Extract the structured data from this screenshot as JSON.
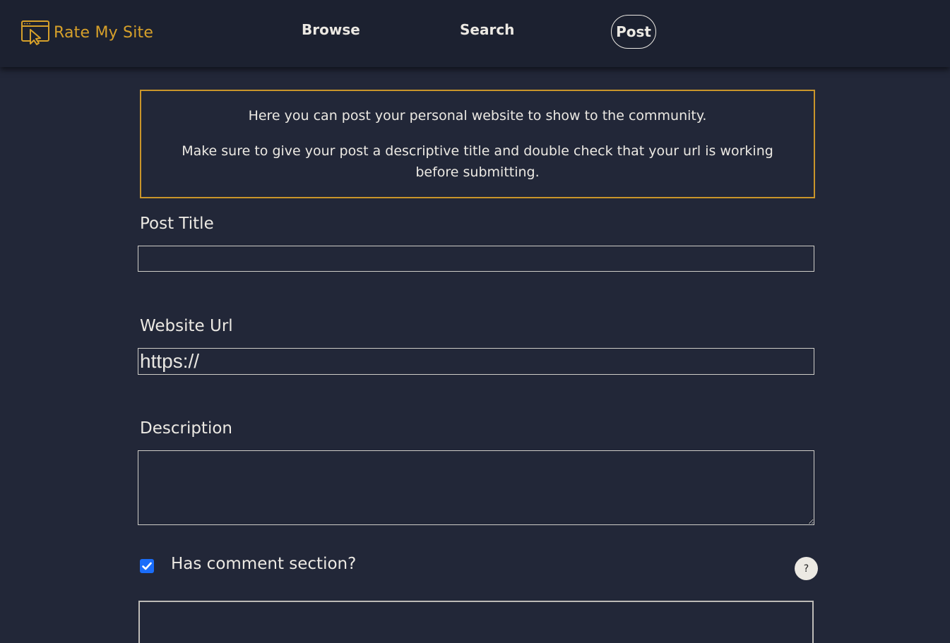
{
  "header": {
    "logo_text": "Rate My Site",
    "logo_icon": "browser-cursor-icon",
    "brand_color": "#d6a02a",
    "nav": {
      "browse": "Browse",
      "search": "Search",
      "post": "Post"
    },
    "active_nav": "post"
  },
  "info": {
    "line1": "Here you can post your personal website to show to the community.",
    "line2": "Make sure to give your post a descriptive title and double check that your url is working before submitting."
  },
  "form": {
    "title_label": "Post Title",
    "title_value": "",
    "url_label": "Website Url",
    "url_value": "https://",
    "description_label": "Description",
    "description_value": "",
    "comment_section_label": "Has comment section?",
    "comment_section_checked": true,
    "help_label": "?"
  }
}
